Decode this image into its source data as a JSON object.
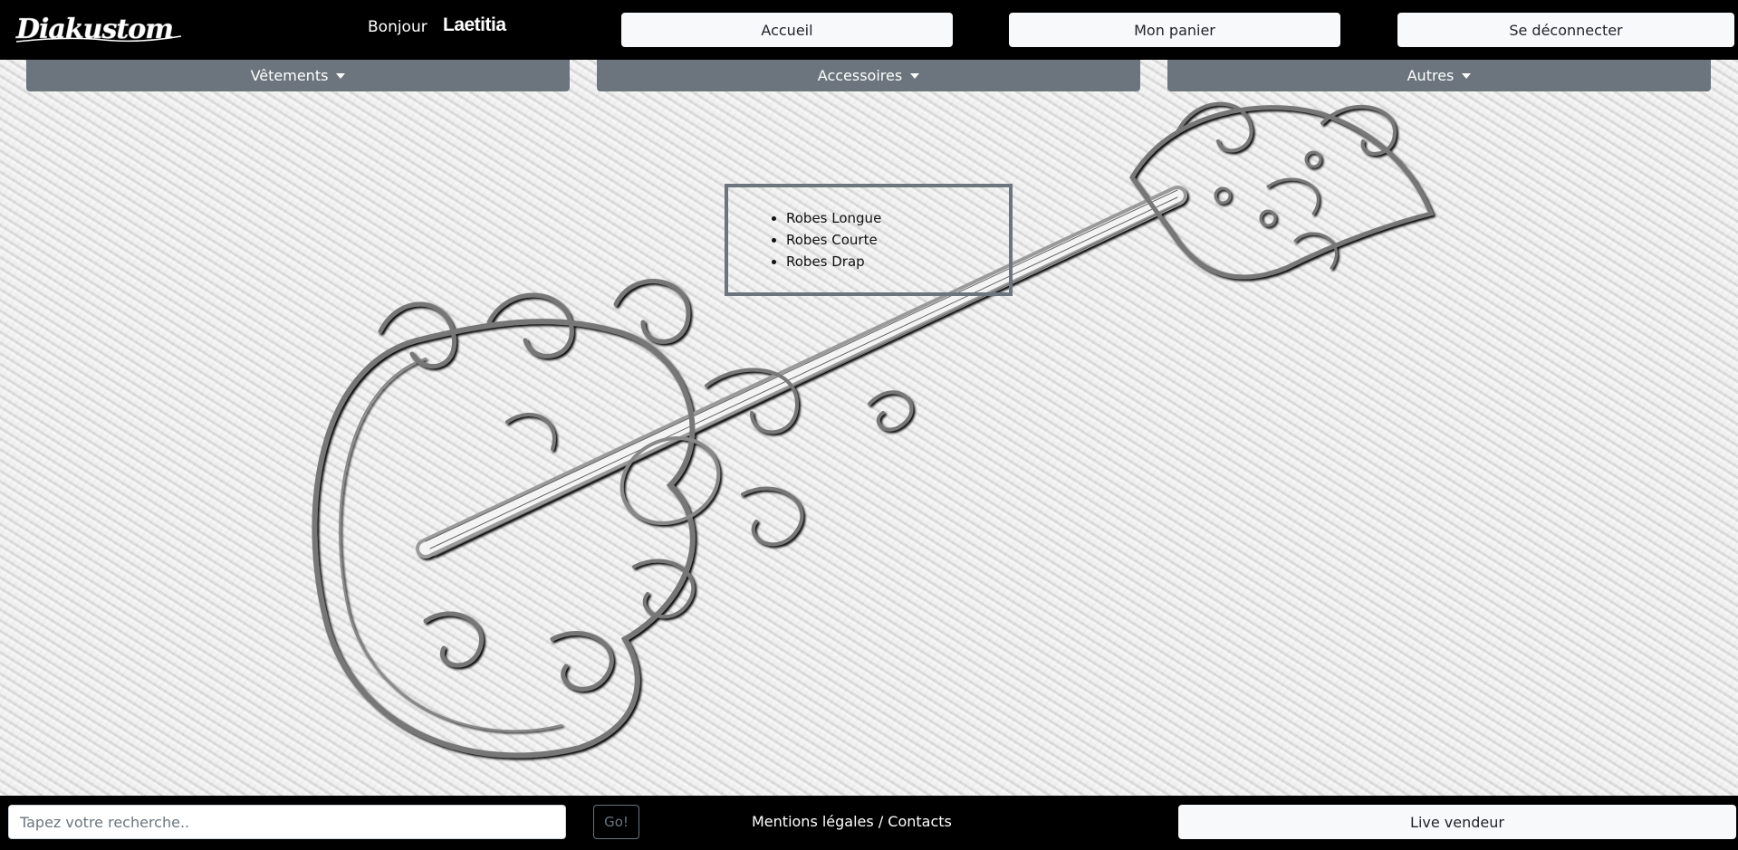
{
  "header": {
    "logo_text": "Diakustom",
    "greeting": "Bonjour",
    "username": "Laetitia",
    "buttons": {
      "home": "Accueil",
      "cart": "Mon panier",
      "logout": "Se déconnecter"
    }
  },
  "categories": [
    {
      "label": "Vêtements"
    },
    {
      "label": "Accessoires"
    },
    {
      "label": "Autres"
    }
  ],
  "dropdown": {
    "items": [
      "Robes Longue",
      "Robes Courte",
      "Robes Drap"
    ]
  },
  "footer": {
    "search_placeholder": "Tapez votre recherche..",
    "go_label": "Go!",
    "legal_link": "Mentions légales / Contacts",
    "live_button": "Live vendeur"
  },
  "colors": {
    "header_bg": "#000000",
    "category_bg": "#6c757d",
    "button_bg": "#f8f9fa"
  }
}
